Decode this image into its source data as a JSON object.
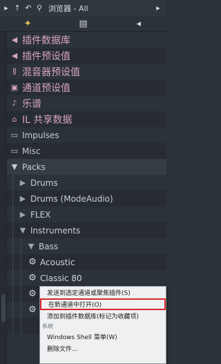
{
  "topbar": {
    "icons": [
      "triangle-icon",
      "arrow-up-icon",
      "undo-icon",
      "search-icon"
    ],
    "title": "浏览器 - All",
    "glyphs": [
      "▸",
      "↑",
      "↶",
      "⚲"
    ],
    "more": "▸"
  },
  "tabs": [
    {
      "label": "✦",
      "active": true
    },
    {
      "label": "▤",
      "active": false
    },
    {
      "label": "◂",
      "active": false
    }
  ],
  "tree": {
    "items": [
      {
        "label": "插件数据库",
        "glyph": "◀",
        "style": "pink"
      },
      {
        "label": "插件预设值",
        "glyph": "◀",
        "style": "pink"
      },
      {
        "label": "混音器预设值",
        "glyph": "⫼",
        "style": "pink"
      },
      {
        "label": "通道预设值",
        "glyph": "▣",
        "style": "pink"
      },
      {
        "label": "乐谱",
        "glyph": "♪",
        "style": "pink"
      },
      {
        "label": "IL 共享数据",
        "glyph": "⌂",
        "style": "pink"
      },
      {
        "label": "Impulses",
        "glyph": "▭",
        "style": "gray"
      },
      {
        "label": "Misc",
        "glyph": "▭",
        "style": "gray"
      },
      {
        "label": "Packs",
        "glyph": "▼",
        "style": "sel"
      },
      {
        "label": "Drums",
        "glyph": "▶",
        "style": "pack"
      },
      {
        "label": "Drums (ModeAudio)",
        "glyph": "▶",
        "style": "pack"
      },
      {
        "label": "FLEX",
        "glyph": "▶",
        "style": "pack"
      },
      {
        "label": "Instruments",
        "glyph": "▼",
        "style": "pack"
      },
      {
        "label": "Bass",
        "glyph": "▼",
        "style": "pack"
      },
      {
        "label": "Acoustic",
        "glyph": "⚙",
        "style": "gear"
      },
      {
        "label": "Classic 80",
        "glyph": "⚙",
        "style": "gear"
      }
    ]
  },
  "context_menu": {
    "items": [
      {
        "label": "发送到选定通道或聚焦插件(S)",
        "type": "item"
      },
      {
        "label": "在新通道中打开(O)",
        "type": "item",
        "highlighted": true
      },
      {
        "label": "添加到插件数据库(标记为收藏项)",
        "type": "item"
      },
      {
        "label": "系统",
        "type": "section"
      },
      {
        "label": "Windows Shell 菜单(W)",
        "type": "item"
      },
      {
        "label": "删除文件...",
        "type": "item"
      }
    ]
  }
}
